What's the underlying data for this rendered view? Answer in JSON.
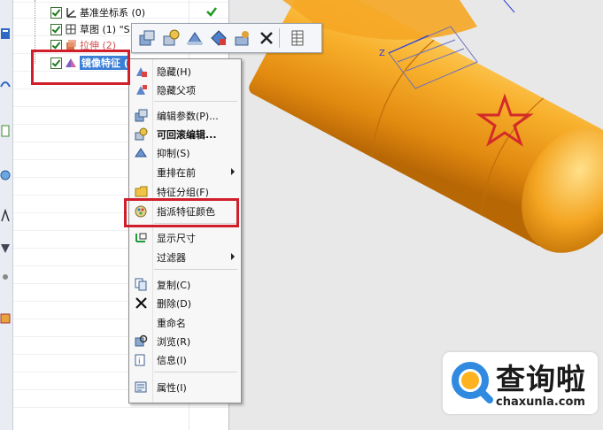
{
  "navigator": {
    "rows": [
      {
        "label": "基准坐标系 (0)"
      },
      {
        "label": "草图 (1) \"S"
      },
      {
        "label": "拉伸 (2)"
      },
      {
        "label": "镜像特征 ("
      }
    ]
  },
  "mini_toolbar": {
    "icons": [
      "edit-parameters-icon",
      "rollback-edit-icon",
      "suppress-icon",
      "assign-color-icon",
      "feature-group-icon",
      "delete-icon",
      "table-icon"
    ]
  },
  "context_menu": {
    "items": [
      {
        "label": "隐藏(H)",
        "icon": "hide-icon"
      },
      {
        "label": "隐藏父项",
        "icon": "hide-parents-icon"
      },
      {
        "label": "编辑参数(P)...",
        "icon": "edit-parameters-icon"
      },
      {
        "label": "可回滚编辑...",
        "icon": "rollback-edit-icon"
      },
      {
        "label": "抑制(S)",
        "icon": "suppress-icon"
      },
      {
        "label": "重排在前",
        "has_submenu": true
      },
      {
        "label": "特征分组(F)",
        "icon": "folder-icon"
      },
      {
        "label": "指派特征颜色",
        "icon": "assign-color-icon"
      },
      {
        "label": "显示尺寸",
        "icon": "show-dimensions-icon"
      },
      {
        "label": "过滤器",
        "has_submenu": true
      },
      {
        "label": "复制(C)",
        "icon": "copy-icon"
      },
      {
        "label": "删除(D)",
        "icon": "delete-icon"
      },
      {
        "label": "重命名"
      },
      {
        "label": "浏览(R)",
        "icon": "browse-icon"
      },
      {
        "label": "信息(I)",
        "icon": "info-icon"
      },
      {
        "label": "属性(I)",
        "icon": "properties-icon"
      }
    ]
  },
  "viewport": {
    "axis_label": "Z",
    "model_color": "#f5a623",
    "star_color": "#d42a2a"
  },
  "watermark": {
    "title": "查询啦",
    "url": "chaxunla.com"
  }
}
